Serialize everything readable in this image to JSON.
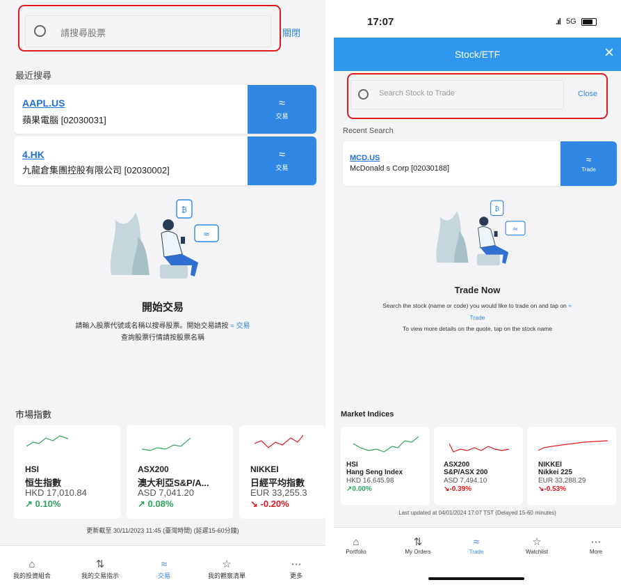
{
  "left": {
    "search": {
      "placeholder": "請搜尋股票",
      "close_label": "關閉"
    },
    "recent_heading": "最近搜尋",
    "recent_items": [
      {
        "symbol": "AAPL.US",
        "name": "蘋果電腦 [02030031]",
        "trade_label": "交易"
      },
      {
        "symbol": "4.HK",
        "name": "九龍倉集團控股有限公司 [02030002]",
        "trade_label": "交易"
      }
    ],
    "empty_title": "開始交易",
    "empty_line1_a": "請輸入股票代號或名稱以搜尋股票。開始交易請按",
    "empty_line1_b": "交易",
    "empty_line2": "查詢股票行情請按股票名稱",
    "market_heading": "市場指數",
    "indices": [
      {
        "code": "HSI",
        "name": "恒生指數",
        "value": "HKD 17,010.84",
        "change": "0.10%",
        "direction": "up",
        "color": "#2aa55a"
      },
      {
        "code": "ASX200",
        "name": "澳大利亞S&P/A...",
        "value": "ASD 7,041.20",
        "change": "0.08%",
        "direction": "up",
        "color": "#2aa55a"
      },
      {
        "code": "NIKKEI",
        "name": "日經平均指數",
        "value": "EUR 33,255.3",
        "change": "-0.20%",
        "direction": "down",
        "color": "#e0191d"
      }
    ],
    "last_updated": "更新截至 30/11/2023 11:45 (臺灣時間) (延遲15-60分鐘)",
    "nav": [
      {
        "label": "我的投資組合",
        "icon": "portfolio-icon",
        "glyph": "⌂"
      },
      {
        "label": "我的交易指示",
        "icon": "orders-icon",
        "glyph": "⇅"
      },
      {
        "label": "交易",
        "icon": "trade-icon",
        "glyph": "≈"
      },
      {
        "label": "我的觀察清單",
        "icon": "star-icon",
        "glyph": "☆"
      },
      {
        "label": "更多",
        "icon": "more-icon",
        "glyph": "⋯"
      }
    ]
  },
  "right": {
    "status": {
      "time": "17:07",
      "network": "5G"
    },
    "header_title": "Stock/ETF",
    "search": {
      "placeholder": "Search Stock to Trade",
      "close_label": "Close"
    },
    "recent_heading": "Recent Search",
    "recent_items": [
      {
        "symbol": "MCD.US",
        "name": "McDonald s Corp [02030188]",
        "trade_label": "Trade"
      }
    ],
    "empty_title": "Trade Now",
    "empty_line1": "Search the stock (name or code) you would like to trade on and tap on",
    "empty_line1_link": "Trade",
    "empty_line2": "To view more details on the quote, tap on the stock name",
    "market_heading": "Market Indices",
    "indices": [
      {
        "code": "HSI",
        "name": "Hang Seng Index",
        "value": "HKD 16,645.98",
        "change": "0.00%",
        "direction": "up",
        "color": "#2aa55a"
      },
      {
        "code": "ASX200",
        "name": "S&P/ASX 200",
        "value": "ASD 7,494.10",
        "change": "-0.39%",
        "direction": "down",
        "color": "#e0191d"
      },
      {
        "code": "NIKKEI",
        "name": "Nikkei 225",
        "value": "EUR 33,288.29",
        "change": "-0.53%",
        "direction": "down",
        "color": "#e0191d"
      }
    ],
    "last_updated": "Last updated at 04/01/2024 17:07 TST (Delayed 15-60 minutes)",
    "nav": [
      {
        "label": "Portfolio",
        "icon": "portfolio-icon",
        "glyph": "⌂"
      },
      {
        "label": "My Orders",
        "icon": "orders-icon",
        "glyph": "⇅"
      },
      {
        "label": "Trade",
        "icon": "trade-icon",
        "glyph": "≈"
      },
      {
        "label": "Watchlist",
        "icon": "star-icon",
        "glyph": "☆"
      },
      {
        "label": "More",
        "icon": "more-icon",
        "glyph": "⋯"
      }
    ]
  }
}
